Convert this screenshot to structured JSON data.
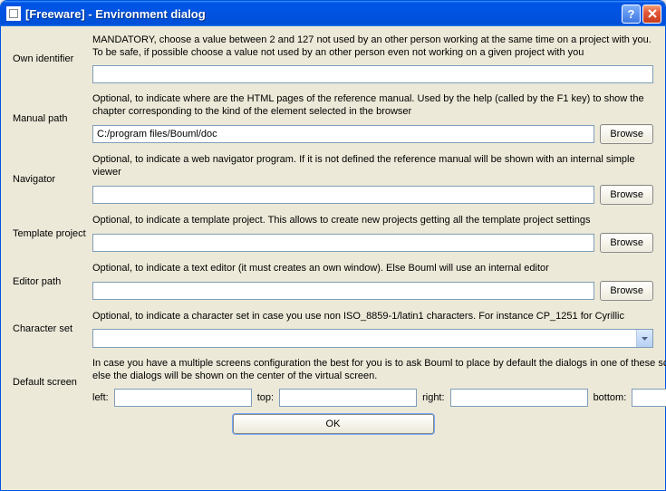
{
  "window": {
    "title": "[Freeware] - Environment dialog"
  },
  "labels": {
    "own_identifier": "Own identifier",
    "manual_path": "Manual path",
    "navigator": "Navigator",
    "template_project": "Template project",
    "editor_path": "Editor path",
    "character_set": "Character set",
    "default_screen": "Default screen",
    "browse": "Browse",
    "ok": "OK",
    "left": "left:",
    "top": "top:",
    "right": "right:",
    "bottom": "bottom:"
  },
  "desc": {
    "own_identifier": "MANDATORY, choose a value between 2 and 127 not used by an other person working at the same time on a project with you. To be safe, if possible choose a value not used by an other person even not working on a given project with you",
    "manual_path": "Optional, to indicate where are the HTML pages of the reference manual. Used by the help (called by the F1 key) to show the chapter corresponding to the kind of the element selected in the browser",
    "navigator": "Optional, to indicate a web navigator program. If it is not defined the reference manual will be shown with an internal simple viewer",
    "template_project": "Optional, to indicate a template project. This allows to create new projects getting all the template project settings",
    "editor_path": "Optional, to indicate a text editor (it must creates an own window). Else Bouml will use an internal editor",
    "character_set": "Optional, to indicate a character set in case you use non ISO_8859-1/latin1 characters. For instance CP_1251 for Cyrillic",
    "default_screen": "In case you have a multiple screens configuration the best for you is to ask Bouml to place by default the dialogs in one of these screens giving the area, else the dialogs will be shown on the center of the virtual screen."
  },
  "values": {
    "own_identifier": "",
    "manual_path": "C:/program files/Bouml/doc",
    "navigator": "",
    "template_project": "",
    "editor_path": "",
    "character_set": "",
    "screen_left": "",
    "screen_top": "",
    "screen_right": "",
    "screen_bottom": ""
  }
}
